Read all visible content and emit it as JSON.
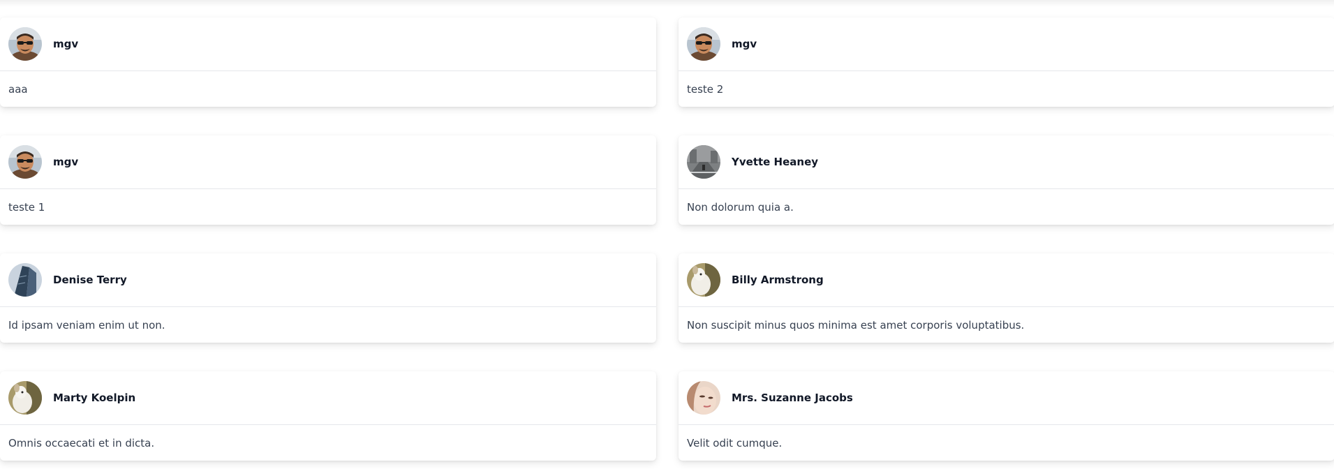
{
  "posts": [
    {
      "author": "mgv",
      "avatar_icon": "man-sunglasses-avatar",
      "content": "aaa"
    },
    {
      "author": "mgv",
      "avatar_icon": "man-sunglasses-avatar",
      "content": "teste 2"
    },
    {
      "author": "mgv",
      "avatar_icon": "man-sunglasses-avatar",
      "content": "teste 1"
    },
    {
      "author": "Yvette Heaney",
      "avatar_icon": "street-photo-avatar",
      "content": "Non dolorum quia a."
    },
    {
      "author": "Denise Terry",
      "avatar_icon": "skyscraper-avatar",
      "content": "Id ipsam veniam enim ut non."
    },
    {
      "author": "Billy Armstrong",
      "avatar_icon": "dog-avatar",
      "content": "Non suscipit minus quos minima est amet corporis voluptatibus."
    },
    {
      "author": "Marty Koelpin",
      "avatar_icon": "dog-avatar",
      "content": "Omnis occaecati et in dicta."
    },
    {
      "author": "Mrs. Suzanne Jacobs",
      "avatar_icon": "woman-face-avatar",
      "content": "Velit odit cumque."
    }
  ],
  "colors": {
    "card_background": "#ffffff",
    "divider": "#e5e7eb",
    "author_text": "#111827",
    "body_text": "#374151"
  }
}
